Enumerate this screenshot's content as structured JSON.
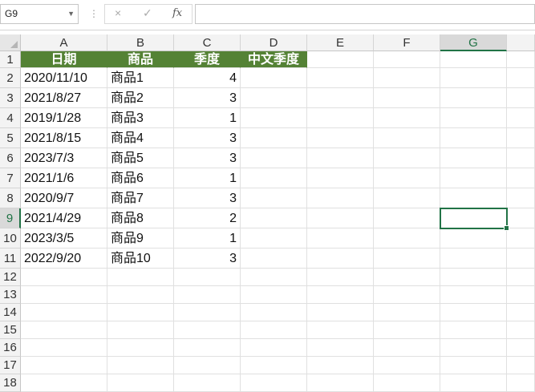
{
  "formula_bar": {
    "name_box": "G9",
    "cancel_icon": "×",
    "enter_icon": "✓",
    "fx_label": "fx",
    "formula_value": ""
  },
  "columns": [
    "A",
    "B",
    "C",
    "D",
    "E",
    "F",
    "G"
  ],
  "rows": [
    "1",
    "2",
    "3",
    "4",
    "5",
    "6",
    "7",
    "8",
    "9",
    "10",
    "11",
    "12",
    "13",
    "14",
    "15",
    "16",
    "17",
    "18"
  ],
  "selected_cell": "G9",
  "table": {
    "headers": [
      "日期",
      "商品",
      "季度",
      "中文季度"
    ],
    "rows": [
      [
        "2020/11/10",
        "商品1",
        "4",
        ""
      ],
      [
        "2021/8/27",
        "商品2",
        "3",
        ""
      ],
      [
        "2019/1/28",
        "商品3",
        "1",
        ""
      ],
      [
        "2021/8/15",
        "商品4",
        "3",
        ""
      ],
      [
        "2023/7/3",
        "商品5",
        "3",
        ""
      ],
      [
        "2021/1/6",
        "商品6",
        "1",
        ""
      ],
      [
        "2020/9/7",
        "商品7",
        "3",
        ""
      ],
      [
        "2021/4/29",
        "商品8",
        "2",
        ""
      ],
      [
        "2023/3/5",
        "商品9",
        "1",
        ""
      ],
      [
        "2022/9/20",
        "商品10",
        "3",
        ""
      ]
    ]
  },
  "colors": {
    "header_fill": "#548235",
    "selection": "#217346"
  }
}
